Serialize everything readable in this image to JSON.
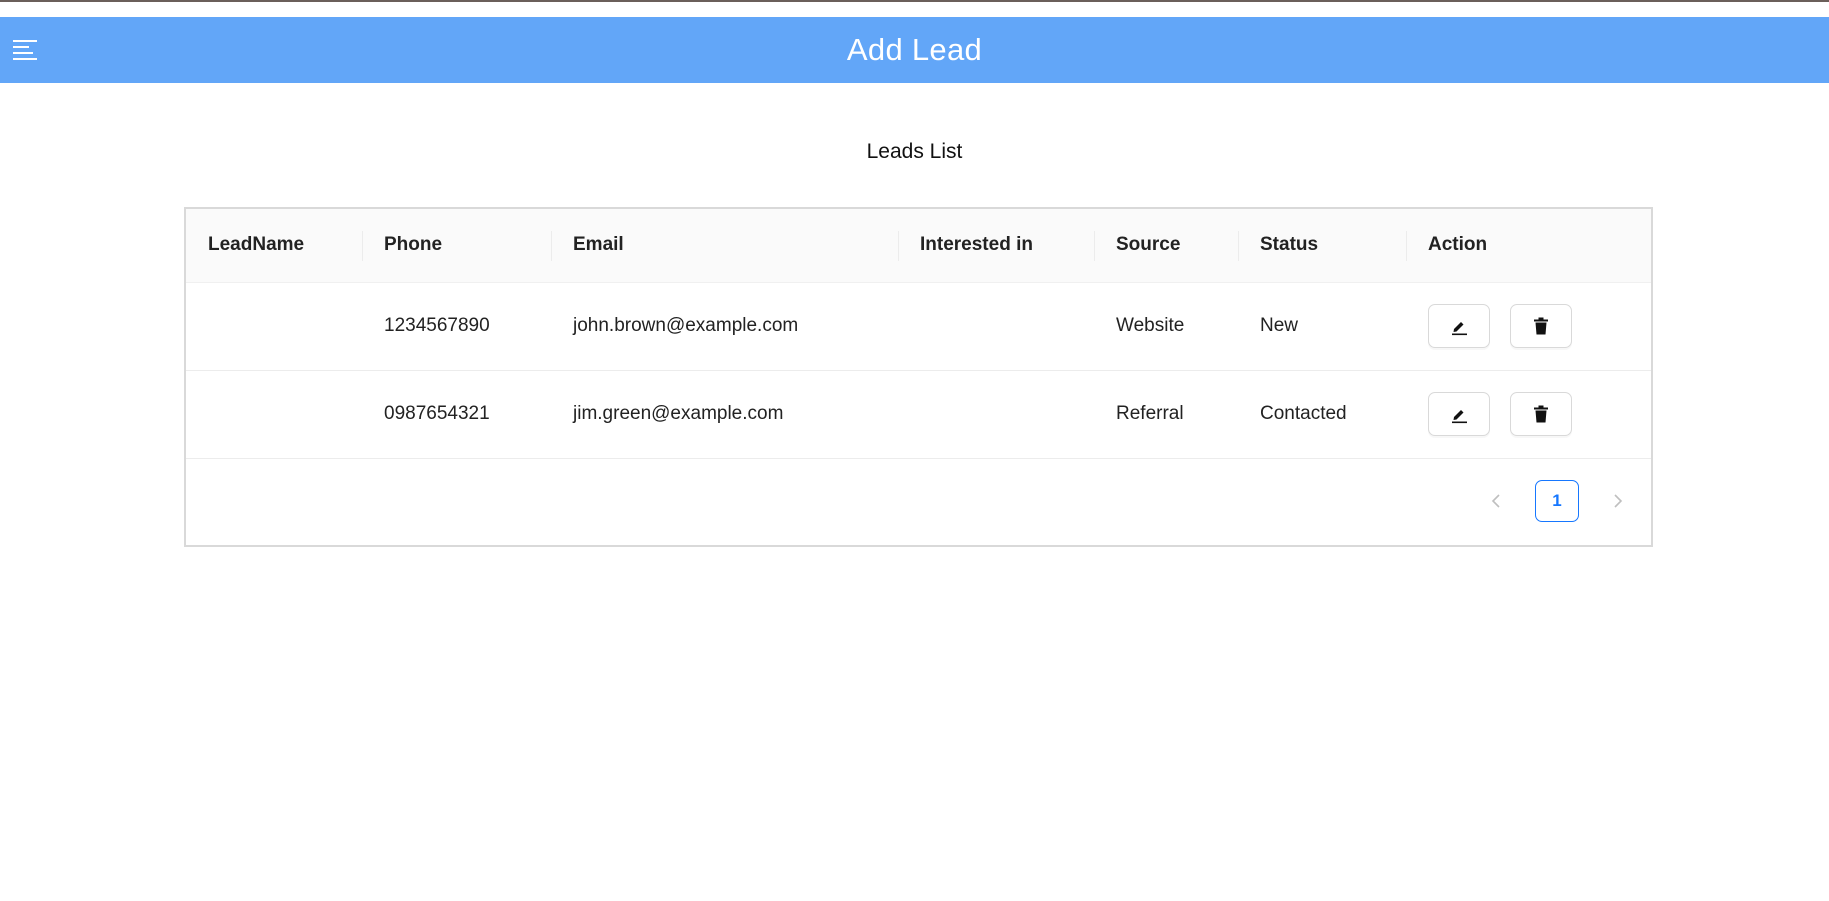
{
  "header": {
    "title": "Add Lead",
    "menu_icon": "menu-icon",
    "background": "#62a6f8"
  },
  "page": {
    "title": "Leads List"
  },
  "table": {
    "columns": [
      "LeadName",
      "Phone",
      "Email",
      "Interested in",
      "Source",
      "Status",
      "Action"
    ],
    "rows": [
      {
        "lead_name": "",
        "phone": "1234567890",
        "email": "john.brown@example.com",
        "interested_in": "",
        "source": "Website",
        "status": "New"
      },
      {
        "lead_name": "",
        "phone": "0987654321",
        "email": "jim.green@example.com",
        "interested_in": "",
        "source": "Referral",
        "status": "Contacted"
      }
    ],
    "action_icons": [
      "edit-icon",
      "delete-icon"
    ]
  },
  "pagination": {
    "current_page": "1",
    "prev_icon": "chevron-left-icon",
    "next_icon": "chevron-right-icon",
    "accent": "#1677ff"
  }
}
